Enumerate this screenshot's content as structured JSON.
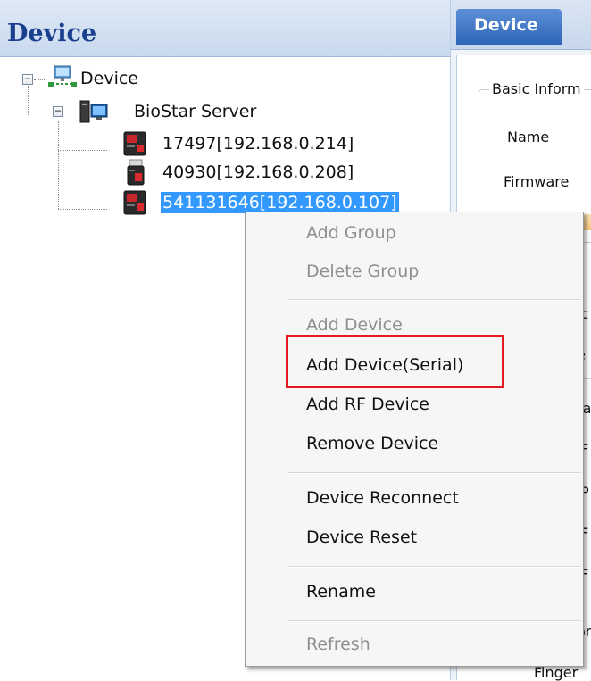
{
  "left_panel": {
    "title": "Device",
    "tree": {
      "root": "Device",
      "server": "BioStar Server",
      "devices": [
        "17497[192.168.0.214]",
        "40930[192.168.0.208]",
        "541131646[192.168.0.107]"
      ]
    }
  },
  "right_panel": {
    "tab": "Device",
    "group_title": "Basic Inform",
    "fields": [
      "Name",
      "Firmware"
    ],
    "truncated_rows": [
      "ic",
      "e",
      "ra",
      "F",
      "P",
      "F",
      "F",
      "or",
      "Finger"
    ]
  },
  "context_menu": {
    "items": [
      {
        "label": "Add Group",
        "enabled": false
      },
      {
        "label": "Delete Group",
        "enabled": false
      },
      {
        "label": "Add Device",
        "enabled": false
      },
      {
        "label": "Add Device(Serial)",
        "enabled": true,
        "highlighted": true
      },
      {
        "label": "Add RF Device",
        "enabled": true
      },
      {
        "label": "Remove Device",
        "enabled": true
      },
      {
        "label": "Device Reconnect",
        "enabled": true
      },
      {
        "label": "Device Reset",
        "enabled": true
      },
      {
        "label": "Rename",
        "enabled": true
      },
      {
        "label": "Refresh",
        "enabled": false
      }
    ]
  },
  "colors": {
    "selection": "#3399ff",
    "highlight_border": "#e21b23",
    "header_title": "#1a3f8f",
    "tab": "#2f65b8"
  },
  "icons": [
    "collapse-icon",
    "network-icon",
    "server-icon",
    "device-icon"
  ]
}
